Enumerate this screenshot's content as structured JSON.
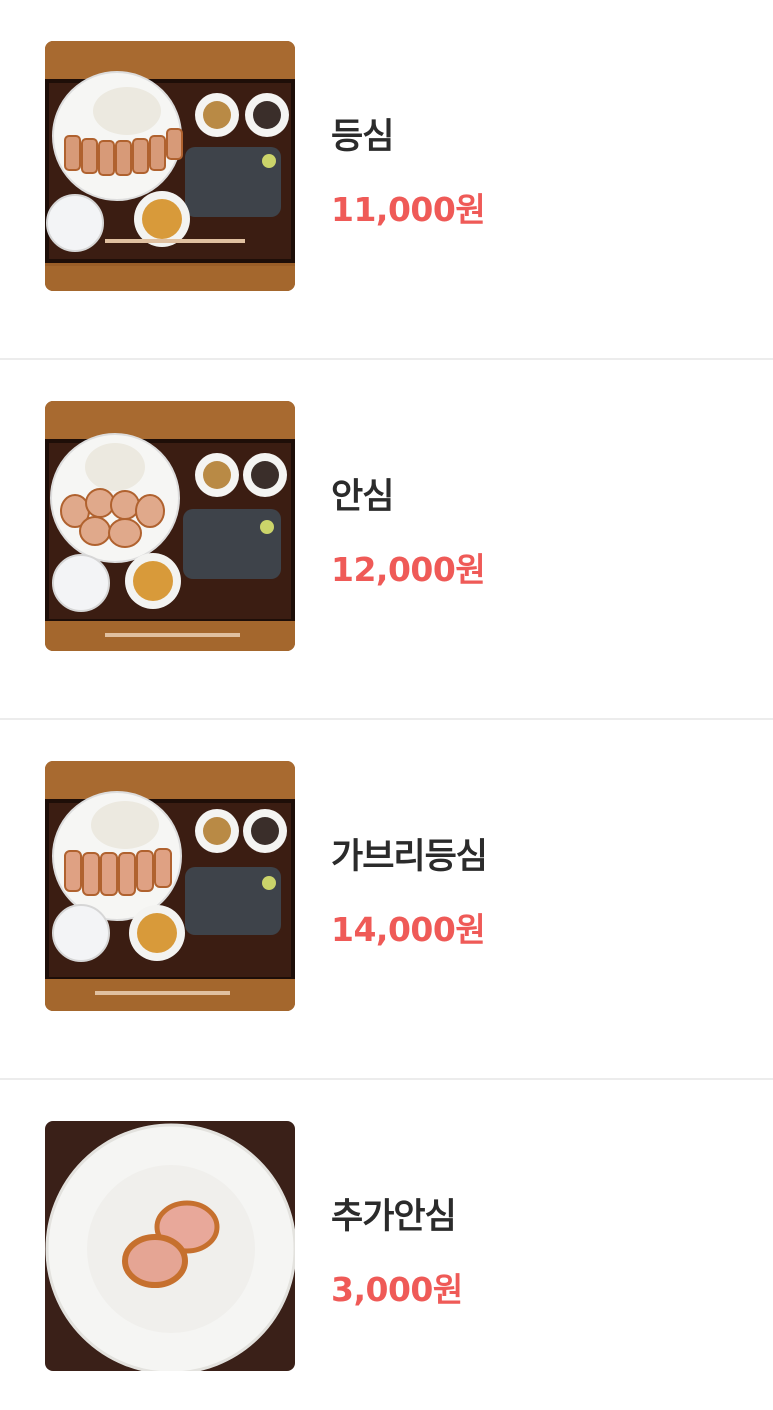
{
  "menu": {
    "items": [
      {
        "name": "등심",
        "price": "11,000원",
        "image": "tonkatsu-set-photo"
      },
      {
        "name": "안심",
        "price": "12,000원",
        "image": "tonkatsu-set-photo"
      },
      {
        "name": "가브리등심",
        "price": "14,000원",
        "image": "tonkatsu-set-photo"
      },
      {
        "name": "추가안심",
        "price": "3,000원",
        "image": "fillet-cutlet-plate-photo"
      }
    ]
  },
  "colors": {
    "price": "#ef5a57",
    "name": "#2b2b2b",
    "divider": "#ececec"
  }
}
